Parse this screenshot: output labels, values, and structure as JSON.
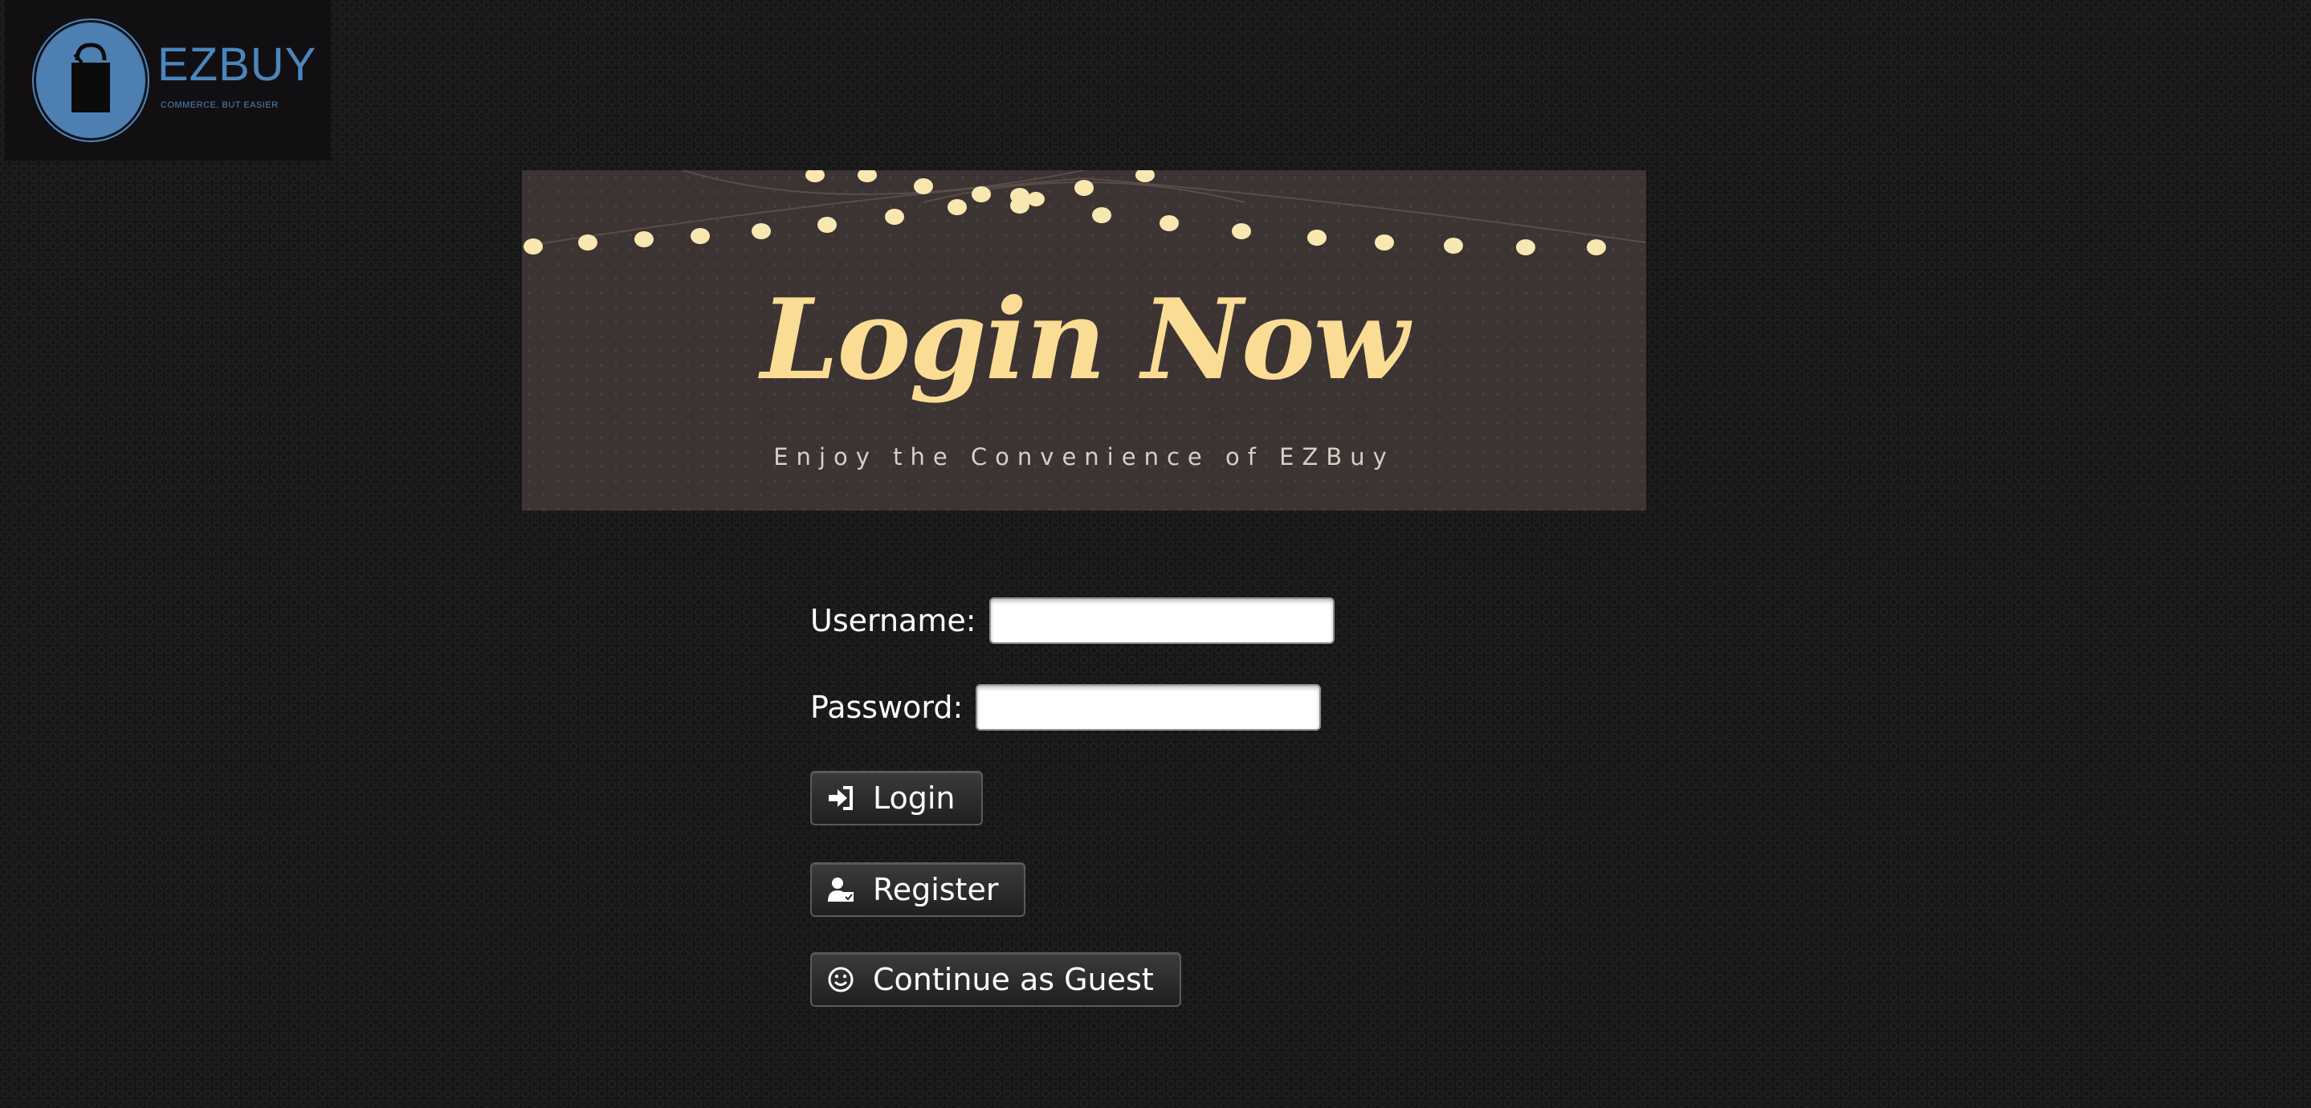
{
  "logo": {
    "name": "EZBUY",
    "tagline": "COMMERCE, BUT EASIER",
    "icon": "shopping-bag-icon",
    "color": "#4a86bd"
  },
  "banner": {
    "title": "Login Now",
    "subtitle": "Enjoy the Convenience of EZBuy"
  },
  "form": {
    "username_label": "Username:",
    "username_value": "",
    "password_label": "Password:",
    "password_value": ""
  },
  "buttons": {
    "login": {
      "label": "Login",
      "icon": "sign-in-icon"
    },
    "register": {
      "label": "Register",
      "icon": "user-register-icon"
    },
    "guest": {
      "label": "Continue as Guest",
      "icon": "smile-icon"
    }
  },
  "colors": {
    "background": "#161616",
    "banner_bg": "#3c3333",
    "banner_title": "#fbdc94"
  }
}
